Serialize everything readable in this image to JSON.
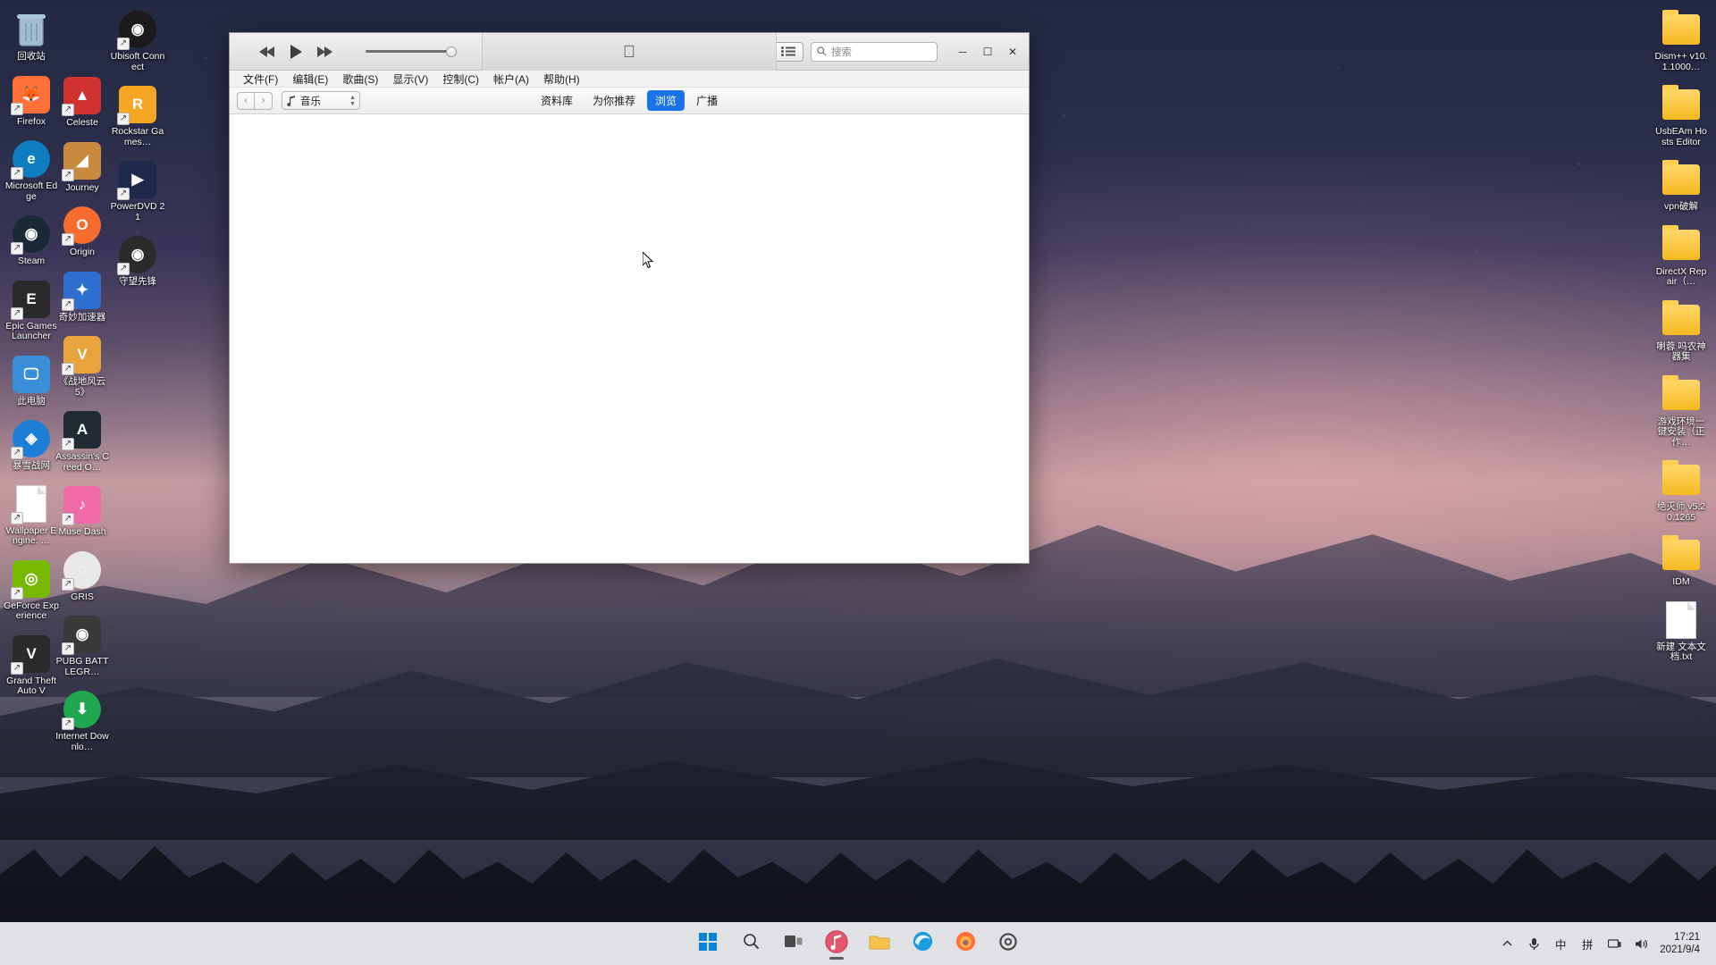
{
  "desktop": {
    "columns": {
      "left": [
        {
          "label": "回收站",
          "icon": "recycle-bin-icon",
          "kind": "recycle",
          "shortcut": false
        },
        {
          "label": "Firefox",
          "icon": "firefox-icon",
          "kind": "tile",
          "color": "#ff7139",
          "shortcut": true,
          "glyph": "🦊"
        },
        {
          "label": "Microsoft Edge",
          "icon": "edge-icon",
          "kind": "round",
          "color": "#0f7ec0",
          "shortcut": true,
          "glyph": "e"
        },
        {
          "label": "Steam",
          "icon": "steam-icon",
          "kind": "round",
          "color": "#1b2838",
          "shortcut": true,
          "glyph": "◉"
        },
        {
          "label": "Epic Games Launcher",
          "icon": "epic-games-icon",
          "kind": "tile",
          "color": "#2a2a2a",
          "shortcut": true,
          "glyph": "E"
        },
        {
          "label": "此电脑",
          "icon": "this-pc-icon",
          "kind": "tile",
          "color": "#3a8fd8",
          "shortcut": false,
          "glyph": "🖵"
        },
        {
          "label": "暴雪战网",
          "icon": "battlenet-icon",
          "kind": "round",
          "color": "#1c7ed6",
          "shortcut": true,
          "glyph": "◈"
        },
        {
          "label": "Wallpaper Engine: …",
          "icon": "wallpaper-engine-icon",
          "kind": "doc",
          "shortcut": true,
          "glyph": ""
        },
        {
          "label": "GeForce Experience",
          "icon": "geforce-experience-icon",
          "kind": "tile",
          "color": "#76b900",
          "shortcut": true,
          "glyph": "◎"
        },
        {
          "label": "Grand Theft Auto V",
          "icon": "gta-v-icon",
          "kind": "tile",
          "color": "#2b2b2b",
          "shortcut": true,
          "glyph": "V"
        }
      ],
      "left2": [
        {
          "label": "Celeste",
          "icon": "celeste-icon",
          "kind": "tile",
          "color": "#d0332f",
          "shortcut": true,
          "glyph": "▲"
        },
        {
          "label": "Journey",
          "icon": "journey-icon",
          "kind": "tile",
          "color": "#c98a3f",
          "shortcut": true,
          "glyph": "◢"
        },
        {
          "label": "Origin",
          "icon": "origin-icon",
          "kind": "round",
          "color": "#f56c2d",
          "shortcut": true,
          "glyph": "O"
        },
        {
          "label": "奇妙加速器",
          "icon": "accelerator-icon",
          "kind": "tile",
          "color": "#2f6fd0",
          "shortcut": true,
          "glyph": "✦"
        },
        {
          "label": "《战地风云 5》",
          "icon": "battlefield-5-icon",
          "kind": "tile",
          "color": "#e8a33d",
          "shortcut": true,
          "glyph": "V"
        },
        {
          "label": "Assassin's Creed O…",
          "icon": "assassins-creed-icon",
          "kind": "tile",
          "color": "#1f2a33",
          "shortcut": true,
          "glyph": "A"
        },
        {
          "label": "Muse Dash",
          "icon": "muse-dash-icon",
          "kind": "tile",
          "color": "#f06aa8",
          "shortcut": true,
          "glyph": "♪"
        },
        {
          "label": "GRIS",
          "icon": "gris-icon",
          "kind": "round",
          "color": "#e8e8e8",
          "shortcut": true,
          "glyph": "◌"
        },
        {
          "label": "PUBG BATTLEGR…",
          "icon": "pubg-icon",
          "kind": "tile",
          "color": "#3a3a3a",
          "shortcut": true,
          "glyph": "◉"
        },
        {
          "label": "Internet Downlo…",
          "icon": "internet-download-manager-icon",
          "kind": "round",
          "color": "#1fa84f",
          "shortcut": true,
          "glyph": "⬇"
        }
      ],
      "left3": [
        {
          "label": "Ubisoft Connect",
          "icon": "ubisoft-connect-icon",
          "kind": "round",
          "color": "#1b1b1b",
          "shortcut": true,
          "glyph": "◉"
        },
        {
          "label": "Rockstar Games…",
          "icon": "rockstar-games-icon",
          "kind": "tile",
          "color": "#f5a623",
          "shortcut": true,
          "glyph": "R"
        },
        {
          "label": "PowerDVD 21",
          "icon": "powerdvd-icon",
          "kind": "tile",
          "color": "#1f2a4a",
          "shortcut": true,
          "glyph": "▶"
        },
        {
          "label": "守望先锋",
          "icon": "overwatch-icon",
          "kind": "round",
          "color": "#2b2b2b",
          "shortcut": true,
          "glyph": "◉"
        }
      ],
      "right": [
        {
          "label": "Dism++ v10.1.1000…",
          "icon": "folder-icon",
          "kind": "folder",
          "shortcut": false
        },
        {
          "label": "UsbEAm Hosts Editor",
          "icon": "folder-icon",
          "kind": "folder",
          "shortcut": false
        },
        {
          "label": "vpn破解",
          "icon": "folder-icon",
          "kind": "folder",
          "shortcut": false
        },
        {
          "label": "DirectX Repair（…",
          "icon": "folder-icon",
          "kind": "folder",
          "shortcut": false
        },
        {
          "label": "喇蓉 吗农神器集",
          "icon": "folder-icon",
          "kind": "folder",
          "shortcut": false
        },
        {
          "label": "游戏环境一键安装（正作…",
          "icon": "folder-icon",
          "kind": "folder",
          "shortcut": false
        },
        {
          "label": "绝灭师 v5.20.1265",
          "icon": "folder-icon",
          "kind": "folder",
          "shortcut": false
        },
        {
          "label": "IDM",
          "icon": "folder-icon",
          "kind": "folder",
          "shortcut": false
        },
        {
          "label": "新建 文本文档.txt",
          "icon": "text-file-icon",
          "kind": "doc",
          "shortcut": false
        }
      ]
    }
  },
  "itunes": {
    "window_controls": {
      "minimize": "─",
      "maximize": "☐",
      "close": "✕"
    },
    "transport": {
      "rewind": "rewind-icon",
      "play": "play-icon",
      "fastforward": "fast-forward-icon",
      "volume_value": 100
    },
    "center_logo": "apple-logo-icon",
    "list_view_button": "list-view-icon",
    "search": {
      "icon": "search-icon",
      "placeholder": "搜索",
      "value": ""
    },
    "menus": [
      "文件(F)",
      "编辑(E)",
      "歌曲(S)",
      "显示(V)",
      "控制(C)",
      "帐户(A)",
      "帮助(H)"
    ],
    "nav": {
      "back": "‹",
      "forward": "›",
      "media_selector": {
        "icon": "music-note-icon",
        "label": "音乐"
      }
    },
    "tabs": [
      {
        "label": "资料库",
        "active": false
      },
      {
        "label": "为你推荐",
        "active": false
      },
      {
        "label": "浏览",
        "active": true
      },
      {
        "label": "广播",
        "active": false
      }
    ],
    "accent_color": "#1a73e8",
    "content": ""
  },
  "taskbar": {
    "buttons": [
      {
        "name": "start-button",
        "icon": "windows-logo-icon",
        "active": false
      },
      {
        "name": "search-button",
        "icon": "search-icon",
        "active": false
      },
      {
        "name": "task-view-button",
        "icon": "task-view-icon",
        "active": false
      },
      {
        "name": "itunes-taskbar-button",
        "icon": "itunes-icon",
        "active": true
      },
      {
        "name": "file-explorer-button",
        "icon": "folder-icon",
        "active": false
      },
      {
        "name": "edge-button",
        "icon": "edge-icon",
        "active": false
      },
      {
        "name": "firefox-button",
        "icon": "firefox-icon",
        "active": false
      },
      {
        "name": "settings-button",
        "icon": "gear-icon",
        "active": false
      }
    ],
    "tray": [
      {
        "name": "show-hidden-icons",
        "label": "⌃"
      },
      {
        "name": "microphone-icon",
        "label": "🎤"
      },
      {
        "name": "ime-mode",
        "label": "中"
      },
      {
        "name": "ime-pinyin",
        "label": "拼"
      },
      {
        "name": "network-icon",
        "label": "▭"
      },
      {
        "name": "volume-icon",
        "label": "🔊"
      }
    ],
    "clock": {
      "time": "17:21",
      "date": "2021/9/4"
    }
  }
}
